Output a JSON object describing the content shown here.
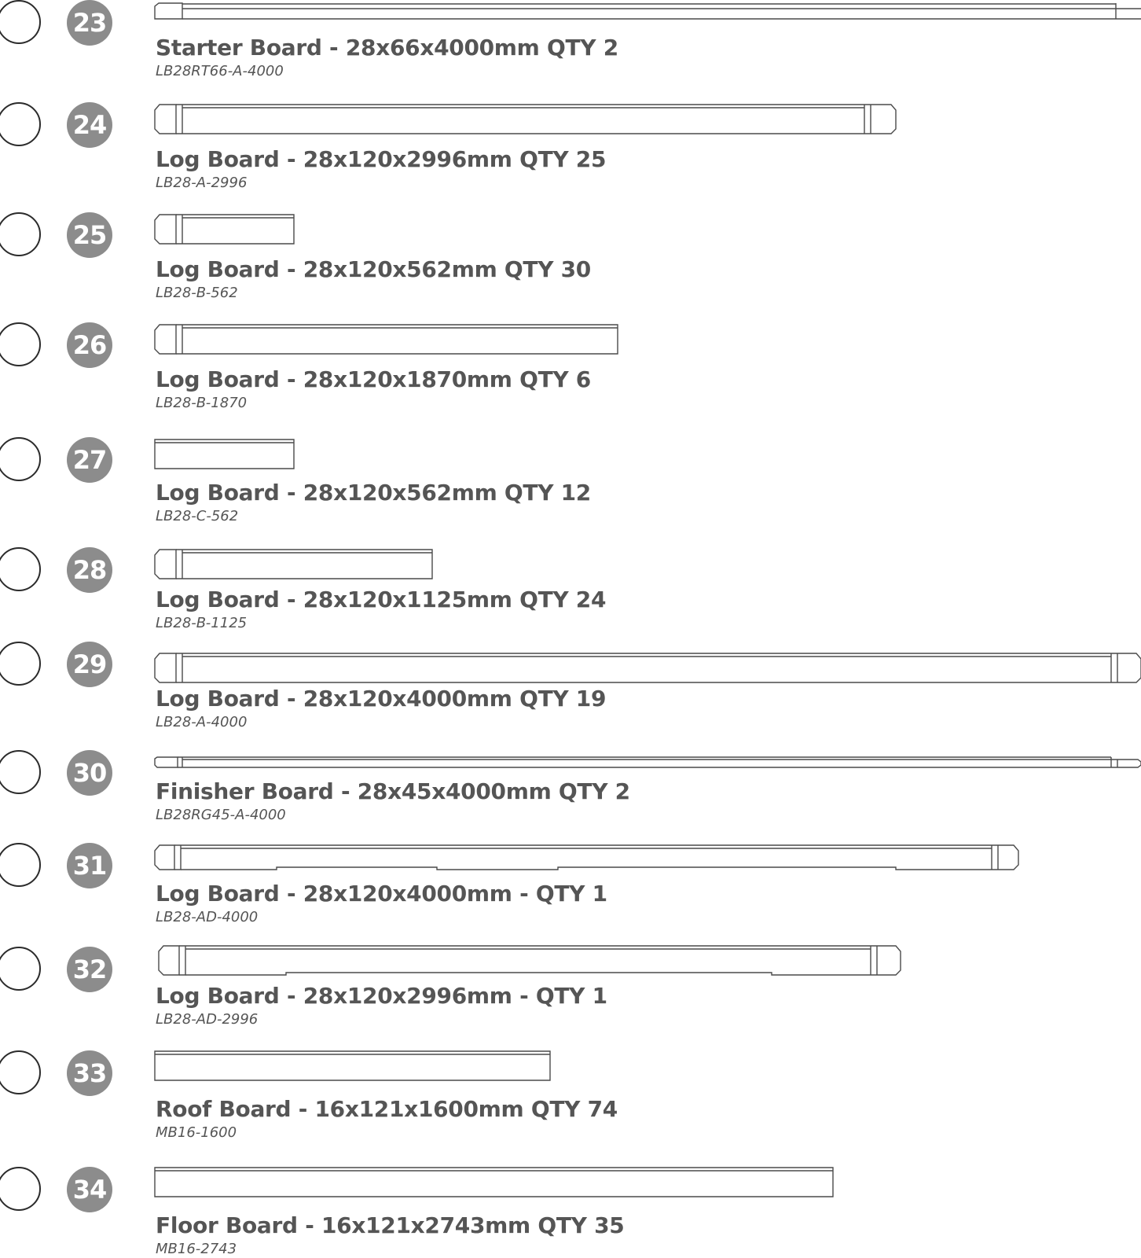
{
  "items": [
    {
      "num": "23",
      "title": "Starter Board - 28x66x4000mm QTY 2",
      "code": "LB28RT66-A-4000"
    },
    {
      "num": "24",
      "title": "Log Board - 28x120x2996mm QTY 25",
      "code": "LB28-A-2996"
    },
    {
      "num": "25",
      "title": "Log Board - 28x120x562mm QTY 30",
      "code": "LB28-B-562"
    },
    {
      "num": "26",
      "title": "Log Board - 28x120x1870mm QTY 6",
      "code": "LB28-B-1870"
    },
    {
      "num": "27",
      "title": "Log Board - 28x120x562mm QTY 12",
      "code": "LB28-C-562"
    },
    {
      "num": "28",
      "title": "Log Board - 28x120x1125mm QTY 24",
      "code": "LB28-B-1125"
    },
    {
      "num": "29",
      "title": "Log Board - 28x120x4000mm QTY 19",
      "code": "LB28-A-4000"
    },
    {
      "num": "30",
      "title": "Finisher Board - 28x45x4000mm QTY 2",
      "code": "LB28RG45-A-4000"
    },
    {
      "num": "31",
      "title": "Log Board - 28x120x4000mm - QTY 1",
      "code": "LB28-AD-4000"
    },
    {
      "num": "32",
      "title": "Log Board - 28x120x2996mm - QTY 1",
      "code": "LB28-AD-2996"
    },
    {
      "num": "33",
      "title": "Roof Board - 16x121x1600mm QTY 74",
      "code": "MB16-1600"
    },
    {
      "num": "34",
      "title": "Floor Board - 16x121x2743mm QTY 35",
      "code": "MB16-2743"
    }
  ]
}
